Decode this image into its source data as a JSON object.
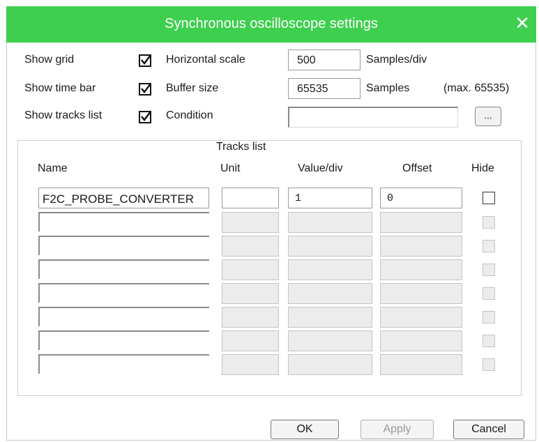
{
  "dialog": {
    "title": "Synchronous oscilloscope settings",
    "close_icon": "✕"
  },
  "options": {
    "show_grid": {
      "label": "Show grid",
      "checked": true
    },
    "show_time_bar": {
      "label": "Show time bar",
      "checked": true
    },
    "show_tracks_list": {
      "label": "Show tracks list",
      "checked": true
    }
  },
  "settings": {
    "horizontal_scale_label": "Horizontal scale",
    "horizontal_scale_value": "500",
    "horizontal_scale_unit": "Samples/div",
    "buffer_size_label": "Buffer size",
    "buffer_size_value": "65535",
    "buffer_size_unit": "Samples",
    "buffer_size_max": "(max. 65535)",
    "condition_label": "Condition",
    "condition_value": "",
    "browse_button": "..."
  },
  "tracks": {
    "group_title": "Tracks list",
    "headers": {
      "name": "Name",
      "unit": "Unit",
      "value_div": "Value/div",
      "offset": "Offset",
      "hide": "Hide"
    },
    "rows": [
      {
        "name": "F2C_PROBE_CONVERTER",
        "unit": "",
        "value_div": "1",
        "offset": "0",
        "hide": false,
        "enabled": true
      },
      {
        "name": "",
        "unit": "",
        "value_div": "",
        "offset": "",
        "hide": false,
        "enabled": false
      },
      {
        "name": "",
        "unit": "",
        "value_div": "",
        "offset": "",
        "hide": false,
        "enabled": false
      },
      {
        "name": "",
        "unit": "",
        "value_div": "",
        "offset": "",
        "hide": false,
        "enabled": false
      },
      {
        "name": "",
        "unit": "",
        "value_div": "",
        "offset": "",
        "hide": false,
        "enabled": false
      },
      {
        "name": "",
        "unit": "",
        "value_div": "",
        "offset": "",
        "hide": false,
        "enabled": false
      },
      {
        "name": "",
        "unit": "",
        "value_div": "",
        "offset": "",
        "hide": false,
        "enabled": false
      },
      {
        "name": "",
        "unit": "",
        "value_div": "",
        "offset": "",
        "hide": false,
        "enabled": false
      }
    ]
  },
  "buttons": {
    "ok": "OK",
    "apply": "Apply",
    "cancel": "Cancel"
  },
  "colors": {
    "titlebar": "#3ecf4f"
  }
}
